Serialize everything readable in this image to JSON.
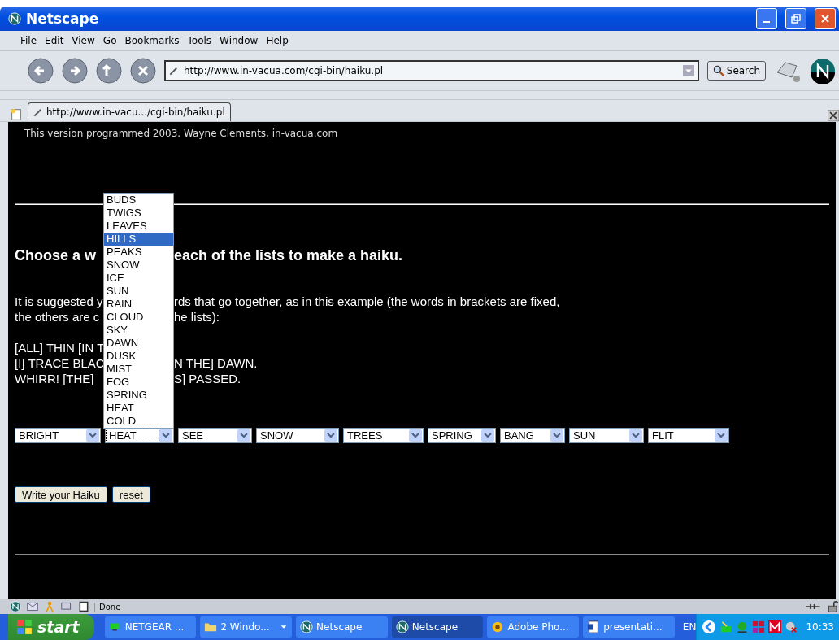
{
  "window": {
    "title": "Netscape"
  },
  "menu": [
    "File",
    "Edit",
    "View",
    "Go",
    "Bookmarks",
    "Tools",
    "Window",
    "Help"
  ],
  "address": {
    "value": "http://www.in-vacua.com/cgi-bin/haiku.pl"
  },
  "search": {
    "label": "Search"
  },
  "tab": {
    "label": "http://www.in-vacu.../cgi-bin/haiku.pl",
    "selected": true
  },
  "page": {
    "credit": "This version programmed 2003. Wayne Clements, in-vacua.com",
    "heading": {
      "left": "Choose a w",
      "right": "each of the lists to make a haiku."
    },
    "paragraph": [
      {
        "left": "It is suggested y",
        "right": "rds that go together, as in this example (the words in brackets are fixed,"
      },
      {
        "left": "the others are c",
        "right": "he lists):"
      }
    ],
    "poem": [
      {
        "left": "[ALL] THIN [IN T"
      },
      {
        "left": "[I] TRACE BLAC",
        "right": "N THE] DAWN."
      },
      {
        "left": "WHIRR! [THE]",
        "right": "S] PASSED."
      }
    ],
    "selects": [
      {
        "value": "BRIGHT",
        "focused": false
      },
      {
        "value": "HEAT",
        "focused": true
      },
      {
        "value": "SEE",
        "focused": false
      },
      {
        "value": "SNOW",
        "focused": false
      },
      {
        "value": "TREES",
        "focused": false
      },
      {
        "value": "SPRING",
        "focused": false
      },
      {
        "value": "BANG",
        "focused": false
      },
      {
        "value": "SUN",
        "focused": false
      },
      {
        "value": "FLIT",
        "focused": false
      }
    ],
    "dropdown": [
      {
        "label": "BUDS",
        "selected": false
      },
      {
        "label": "TWIGS",
        "selected": false
      },
      {
        "label": "LEAVES",
        "selected": false
      },
      {
        "label": "HILLS",
        "selected": true
      },
      {
        "label": "PEAKS",
        "selected": false
      },
      {
        "label": "SNOW",
        "selected": false
      },
      {
        "label": "ICE",
        "selected": false
      },
      {
        "label": "SUN",
        "selected": false
      },
      {
        "label": "RAIN",
        "selected": false
      },
      {
        "label": "CLOUD",
        "selected": false
      },
      {
        "label": "SKY",
        "selected": false
      },
      {
        "label": "DAWN",
        "selected": false
      },
      {
        "label": "DUSK",
        "selected": false
      },
      {
        "label": "MIST",
        "selected": false
      },
      {
        "label": "FOG",
        "selected": false
      },
      {
        "label": "SPRING",
        "selected": false
      },
      {
        "label": "HEAT",
        "selected": false
      },
      {
        "label": "COLD",
        "selected": false
      }
    ],
    "buttons": [
      "Write your Haiku",
      "reset"
    ]
  },
  "status": "Done",
  "taskbar": {
    "start": "start",
    "tasks": [
      {
        "label": "NETGEAR ...",
        "kind": "network",
        "active": false
      },
      {
        "label": "2 Windo...",
        "kind": "folder",
        "active": false
      },
      {
        "label": "Netscape",
        "kind": "browser",
        "active": false
      },
      {
        "label": "Netscape",
        "kind": "browser",
        "active": true
      },
      {
        "label": "Adobe Pho...",
        "kind": "photo",
        "active": false
      },
      {
        "label": "presentati...",
        "kind": "document",
        "active": false
      }
    ],
    "language": "EN",
    "clock": "10:33"
  }
}
